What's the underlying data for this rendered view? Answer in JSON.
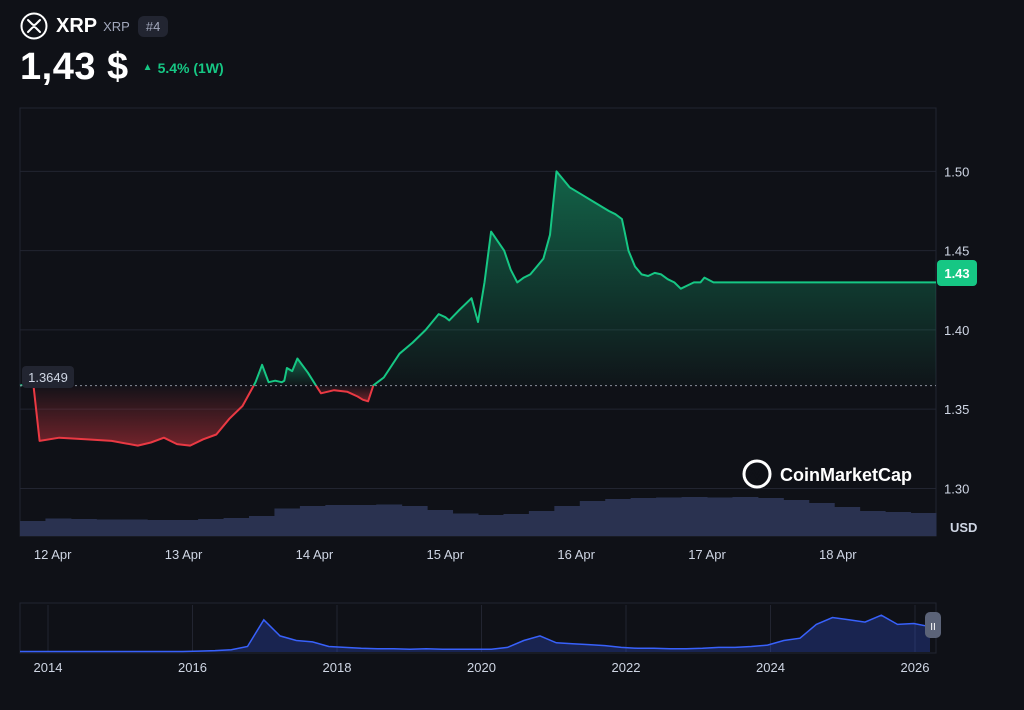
{
  "header": {
    "name": "XRP",
    "symbol": "XRP",
    "rank": "#4",
    "price": "1,43 $",
    "change": "5.4% (1W)",
    "logo_icon": "xrp-logo-icon",
    "change_icon": "triangle-up-icon"
  },
  "colors": {
    "background": "#0f1117",
    "up": "#16c784",
    "down": "#ea3943",
    "volume": "#2a3250",
    "history_line": "#3861fb"
  },
  "watermark": "CoinMarketCap",
  "currency_label": "USD",
  "chart_data": [
    {
      "type": "line",
      "series": [
        {
          "x": [
            0,
            0.1,
            0.15,
            0.3,
            0.5,
            0.7,
            0.9,
            1.0,
            1.1,
            1.2,
            1.3,
            1.4,
            1.5,
            1.6,
            1.7,
            1.8,
            1.85,
            1.9,
            1.95,
            2.0,
            2.02,
            2.04,
            2.08,
            2.12,
            2.2,
            2.3,
            2.4,
            2.5,
            2.58,
            2.62,
            2.66,
            2.7,
            2.78,
            2.9,
            3.0,
            3.1,
            3.2,
            3.25,
            3.28,
            3.35,
            3.45,
            3.5,
            3.55,
            3.6,
            3.7,
            3.75,
            3.8,
            3.85,
            3.9,
            3.95,
            4.0,
            4.05,
            4.1,
            4.2,
            4.3,
            4.4,
            4.5,
            4.55,
            4.6,
            4.62,
            4.65,
            4.7,
            4.75,
            4.8,
            4.85,
            4.9,
            4.95,
            5.0,
            5.05,
            5.1,
            5.15,
            5.2,
            5.23,
            5.3,
            5.35,
            5.4,
            5.45,
            5.5,
            5.6,
            5.7,
            5.75,
            5.8,
            5.85,
            5.9,
            5.95,
            6.0,
            6.05,
            6.1,
            6.15,
            6.2,
            6.25,
            6.3,
            6.35,
            6.4,
            6.45,
            6.5,
            6.55,
            6.6,
            6.65,
            6.7,
            6.75,
            6.8,
            6.85,
            6.9,
            6.95,
            7.0
          ],
          "values": [
            1.3649,
            1.367,
            1.33,
            1.332,
            1.331,
            1.33,
            1.327,
            1.329,
            1.332,
            1.328,
            1.327,
            1.331,
            1.334,
            1.344,
            1.352,
            1.367,
            1.378,
            1.367,
            1.368,
            1.367,
            1.368,
            1.376,
            1.374,
            1.382,
            1.373,
            1.36,
            1.362,
            1.361,
            1.358,
            1.356,
            1.355,
            1.365,
            1.37,
            1.385,
            1.392,
            1.4,
            1.41,
            1.408,
            1.406,
            1.412,
            1.42,
            1.405,
            1.43,
            1.462,
            1.45,
            1.438,
            1.43,
            1.433,
            1.435,
            1.44,
            1.445,
            1.46,
            1.5,
            1.49,
            1.485,
            1.48,
            1.475,
            1.473,
            1.47,
            1.462,
            1.45,
            1.44,
            1.435,
            1.434,
            1.436,
            1.435,
            1.432,
            1.43,
            1.426,
            1.428,
            1.43,
            1.43,
            1.433,
            1.43,
            1.43,
            1.43,
            1.43,
            1.43,
            1.43,
            1.43,
            1.43,
            1.43,
            1.43,
            1.43,
            1.43,
            1.43,
            1.43,
            1.43,
            1.43,
            1.43,
            1.43,
            1.43,
            1.43,
            1.43,
            1.43,
            1.43,
            1.43,
            1.43,
            1.43,
            1.43,
            1.43,
            1.43,
            1.43,
            1.43,
            1.43,
            1.43
          ]
        }
      ],
      "baseline": 1.3649,
      "baseline_label": "1.3649",
      "current_label": "1.43",
      "x_ticks": [
        "12 Apr",
        "13 Apr",
        "14 Apr",
        "15 Apr",
        "16 Apr",
        "17 Apr",
        "18 Apr"
      ],
      "y_ticks": [
        "1.50",
        "1.45",
        "1.40",
        "1.35",
        "1.30"
      ],
      "y_tick_values": [
        1.5,
        1.45,
        1.4,
        1.35,
        1.3
      ],
      "ylim": [
        1.27,
        1.54
      ],
      "grid": true,
      "volume_series": [
        0.3,
        0.35,
        0.34,
        0.33,
        0.33,
        0.32,
        0.32,
        0.34,
        0.36,
        0.4,
        0.55,
        0.6,
        0.62,
        0.62,
        0.63,
        0.6,
        0.52,
        0.45,
        0.42,
        0.44,
        0.5,
        0.6,
        0.7,
        0.74,
        0.76,
        0.77,
        0.78,
        0.77,
        0.78,
        0.76,
        0.72,
        0.66,
        0.58,
        0.5,
        0.48,
        0.46
      ]
    },
    {
      "type": "area",
      "x_ticks": [
        "2014",
        "2016",
        "2018",
        "2020",
        "2022",
        "2024",
        "2026"
      ],
      "values": [
        0.01,
        0.01,
        0.01,
        0.01,
        0.01,
        0.01,
        0.01,
        0.01,
        0.01,
        0.01,
        0.01,
        0.02,
        0.03,
        0.05,
        0.12,
        0.7,
        0.35,
        0.25,
        0.22,
        0.12,
        0.1,
        0.08,
        0.07,
        0.07,
        0.06,
        0.07,
        0.06,
        0.06,
        0.06,
        0.06,
        0.1,
        0.25,
        0.35,
        0.2,
        0.18,
        0.16,
        0.14,
        0.1,
        0.08,
        0.08,
        0.07,
        0.07,
        0.08,
        0.1,
        0.1,
        0.12,
        0.15,
        0.25,
        0.3,
        0.6,
        0.75,
        0.7,
        0.65,
        0.8,
        0.6,
        0.62,
        0.55
      ]
    }
  ]
}
